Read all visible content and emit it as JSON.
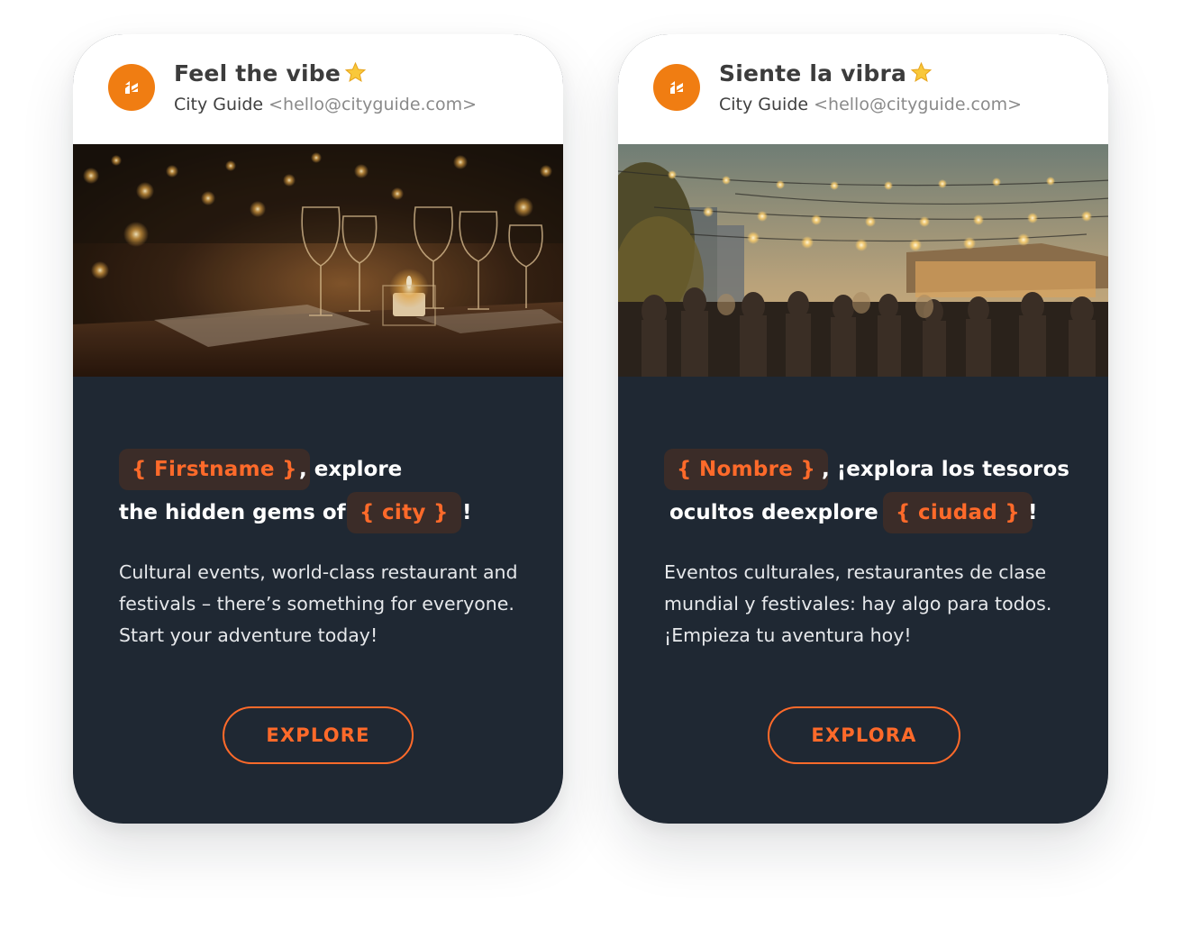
{
  "colors": {
    "accent": "#f07d12",
    "placeholder_text": "#ff6a2a",
    "card_background": "#1f2833"
  },
  "cards": [
    {
      "subject": "Feel the vibe",
      "sender_name": "City Guide",
      "sender_email": "<hello@cityguide.com>",
      "icon": "star-icon",
      "image_alt": "candlelit restaurant table with wine glasses",
      "firstname_token": "{ Firstname }",
      "headline_part1": ", explore",
      "headline_part2": "the hidden gems of",
      "city_token": "{ city }",
      "headline_end": "!",
      "body": "Cultural events, world-class restaurant and festivals – there’s something for everyone. Start your adventure today!",
      "cta_label": "EXPLORE"
    },
    {
      "subject": "Siente la vibra",
      "sender_name": "City Guide",
      "sender_email": "<hello@cityguide.com>",
      "icon": "star-icon",
      "image_alt": "rooftop party with string lights at dusk",
      "firstname_token": "{ Nombre }",
      "headline_part1": ", ¡explora los tesoros",
      "headline_part2": "ocultos deexplore",
      "city_token": "{ ciudad }",
      "headline_end": "!",
      "body": "Eventos culturales, restaurantes de clase mundial y festivales: hay algo para todos. ¡Empieza tu aventura hoy!",
      "cta_label": "EXPLORA"
    }
  ]
}
